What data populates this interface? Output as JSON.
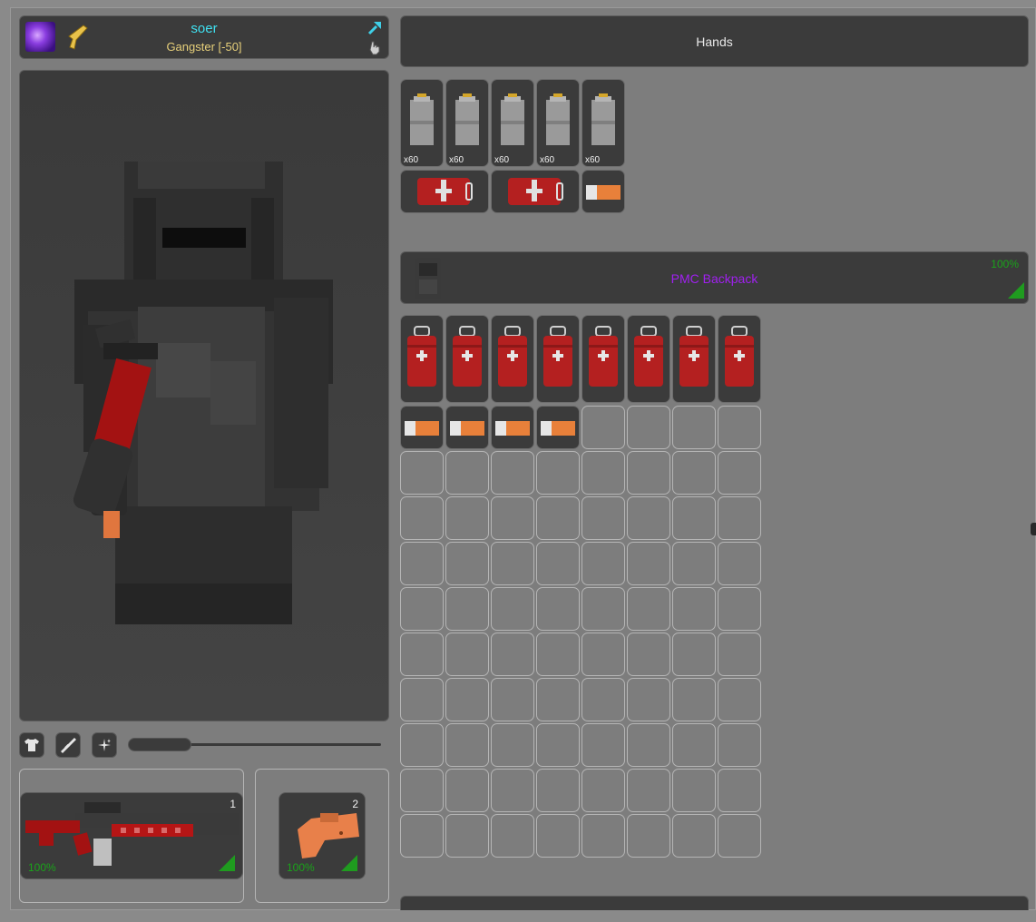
{
  "player": {
    "name": "soer",
    "group": "Gangster [-50]",
    "name_color": "#3fe0f0",
    "group_color": "#e7d07a"
  },
  "hands": {
    "label": "Hands"
  },
  "hands_grid": {
    "row1": [
      {
        "item": "ammo-box",
        "qty": "x60"
      },
      {
        "item": "ammo-box",
        "qty": "x60"
      },
      {
        "item": "ammo-box",
        "qty": "x60"
      },
      {
        "item": "ammo-box",
        "qty": "x60"
      },
      {
        "item": "ammo-box",
        "qty": "x60"
      }
    ],
    "row2": [
      {
        "item": "medkit-bag"
      },
      {
        "item": "medkit-bag"
      },
      {
        "item": "bandage"
      }
    ]
  },
  "backpack": {
    "name": "PMC Backpack",
    "durability": "100%",
    "name_color": "#a020f0",
    "rows": 12,
    "cols": 8,
    "items": {
      "row1": [
        "medkit",
        "medkit",
        "medkit",
        "medkit",
        "medkit",
        "medkit",
        "medkit",
        "medkit"
      ],
      "row2": [
        "bandage",
        "bandage",
        "bandage",
        "bandage"
      ]
    }
  },
  "primary": {
    "slot_number": "1",
    "durability": "100%",
    "accent": "#b01515"
  },
  "secondary": {
    "slot_number": "2",
    "durability": "100%",
    "accent": "#e8804a"
  },
  "tabs": [
    "shirt-icon",
    "weapon-icon",
    "sparkle-icon"
  ]
}
